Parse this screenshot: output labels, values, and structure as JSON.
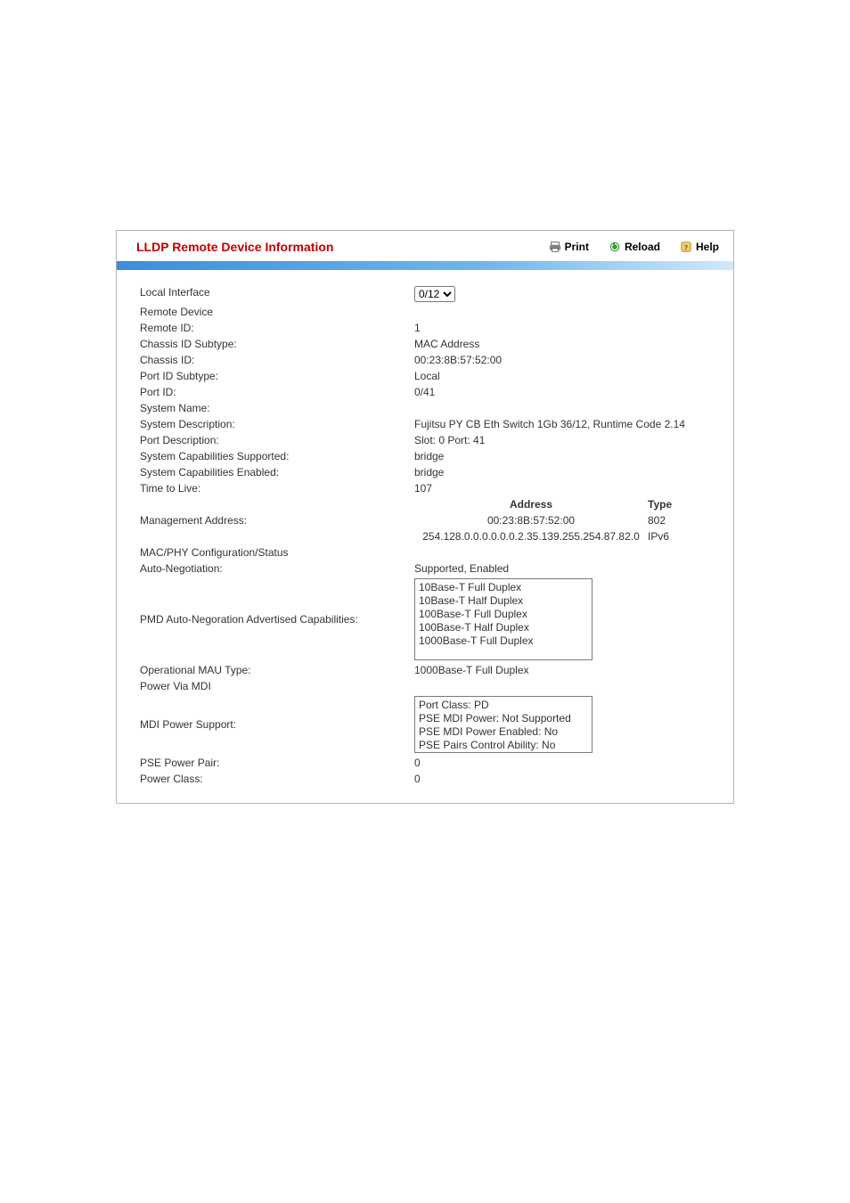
{
  "header": {
    "title": "LLDP Remote Device Information",
    "print": "Print",
    "reload": "Reload",
    "help": "Help"
  },
  "sections": {
    "remote_device": "Remote Device",
    "mac_phy": "MAC/PHY Configuration/Status",
    "power_via_mdi": "Power Via MDI"
  },
  "fields": {
    "local_interface": {
      "label": "Local Interface",
      "value": "0/12"
    },
    "remote_id": {
      "label": "Remote ID:",
      "value": "1"
    },
    "chassis_id_subtype": {
      "label": "Chassis ID Subtype:",
      "value": "MAC Address"
    },
    "chassis_id": {
      "label": "Chassis ID:",
      "value": "00:23:8B:57:52:00"
    },
    "port_id_subtype": {
      "label": "Port ID Subtype:",
      "value": "Local"
    },
    "port_id": {
      "label": "Port ID:",
      "value": "0/41"
    },
    "system_name": {
      "label": "System Name:",
      "value": ""
    },
    "system_description": {
      "label": "System Description:",
      "value": "Fujitsu PY CB Eth Switch 1Gb 36/12, Runtime Code 2.14"
    },
    "port_description": {
      "label": "Port Description:",
      "value": "Slot: 0 Port: 41"
    },
    "sys_caps_supported": {
      "label": "System Capabilities Supported:",
      "value": "bridge"
    },
    "sys_caps_enabled": {
      "label": "System Capabilities Enabled:",
      "value": "bridge"
    },
    "ttl": {
      "label": "Time to Live:",
      "value": "107"
    },
    "mgmt_address": {
      "label": "Management Address:",
      "col_address": "Address",
      "col_type": "Type",
      "rows": [
        {
          "address": "00:23:8B:57:52:00",
          "type": "802"
        },
        {
          "address": "254.128.0.0.0.0.0.0.2.35.139.255.254.87.82.0",
          "type": "IPv6"
        }
      ]
    },
    "auto_neg": {
      "label": "Auto-Negotiation:",
      "value": "Supported, Enabled"
    },
    "pmd_caps": {
      "label": "PMD Auto-Negoration Advertised Capabilities:",
      "items": [
        "10Base-T Full Duplex",
        "10Base-T Half Duplex",
        "100Base-T Full Duplex",
        "100Base-T Half Duplex",
        "1000Base-T Full Duplex"
      ]
    },
    "oper_mau": {
      "label": "Operational MAU Type:",
      "value": "1000Base-T Full Duplex"
    },
    "mdi_power_support": {
      "label": "MDI Power Support:",
      "items": [
        "Port Class: PD",
        "PSE MDI Power: Not Supported",
        "PSE MDI Power Enabled: No",
        "PSE Pairs Control Ability: No"
      ]
    },
    "pse_power_pair": {
      "label": "PSE Power Pair:",
      "value": "0"
    },
    "power_class": {
      "label": "Power Class:",
      "value": "0"
    }
  }
}
